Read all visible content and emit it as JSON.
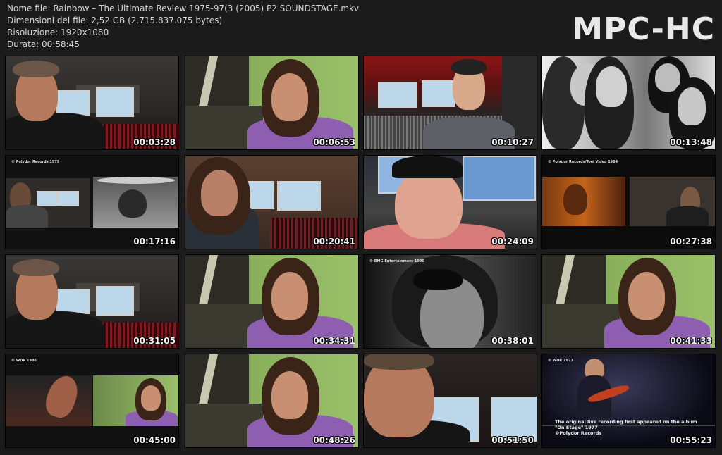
{
  "info": {
    "line1": "Nome file: Rainbow – The Ultimate Review 1975-97(3 (2005) P2 SOUNDSTAGE.mkv",
    "line2": "Dimensioni del file: 2,52 GB (2.715.837.075 bytes)",
    "line3": "Risoluzione: 1920x1080",
    "line4": "Durata: 00:58:45"
  },
  "brand": "MPC-HC",
  "thumbs": [
    {
      "time": "00:03:28",
      "scene": "studio-man",
      "caption": ""
    },
    {
      "time": "00:06:53",
      "scene": "green-longhair",
      "caption": ""
    },
    {
      "time": "00:10:27",
      "scene": "studio-young",
      "caption": ""
    },
    {
      "time": "00:13:48",
      "scene": "bw-band",
      "caption": ""
    },
    {
      "time": "00:17:16",
      "scene": "split-drums",
      "caption": "© Polydor Records 1979"
    },
    {
      "time": "00:20:41",
      "scene": "studio-longhair",
      "caption": ""
    },
    {
      "time": "00:24:09",
      "scene": "cap-man",
      "caption": ""
    },
    {
      "time": "00:27:38",
      "scene": "split-concert",
      "caption": "© Polydor Records/Toei Video 1984"
    },
    {
      "time": "00:31:05",
      "scene": "studio-man",
      "caption": ""
    },
    {
      "time": "00:34:31",
      "scene": "green-longhair",
      "caption": ""
    },
    {
      "time": "00:38:01",
      "scene": "bw-close",
      "caption": "© BMG Entertainment 1996"
    },
    {
      "time": "00:41:33",
      "scene": "green-longhair",
      "caption": ""
    },
    {
      "time": "00:45:00",
      "scene": "split-green",
      "caption": "© WDR 1986"
    },
    {
      "time": "00:48:26",
      "scene": "green-longhair",
      "caption": ""
    },
    {
      "time": "00:51:50",
      "scene": "studio-close",
      "caption": ""
    },
    {
      "time": "00:55:23",
      "scene": "stage",
      "caption": "© WDR 1977"
    }
  ],
  "stage_subtitle": {
    "line1": "The original live recording first appeared on the album",
    "line2": "\"On Stage\" 1977",
    "line3": "©Polydor Records"
  }
}
